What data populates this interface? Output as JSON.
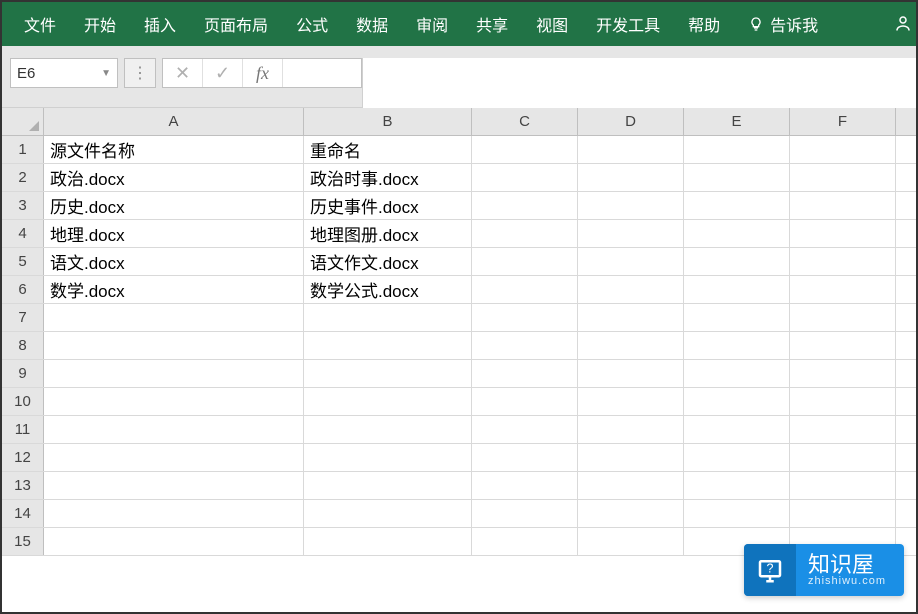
{
  "ribbon": {
    "tabs": [
      "文件",
      "开始",
      "插入",
      "页面布局",
      "公式",
      "数据",
      "审阅",
      "共享",
      "视图",
      "开发工具",
      "帮助"
    ],
    "tellme": "告诉我"
  },
  "namebox": {
    "ref": "E6"
  },
  "fx": {
    "label": "fx"
  },
  "columns": [
    "A",
    "B",
    "C",
    "D",
    "E",
    "F"
  ],
  "col_widths": {
    "A": "col-A",
    "B": "col-B",
    "C": "col-n",
    "D": "col-n",
    "E": "col-n",
    "F": "col-n"
  },
  "rows": [
    {
      "n": "1",
      "A": "源文件名称",
      "B": "重命名"
    },
    {
      "n": "2",
      "A": "政治.docx",
      "B": "政治时事.docx"
    },
    {
      "n": "3",
      "A": "历史.docx",
      "B": "历史事件.docx"
    },
    {
      "n": "4",
      "A": "地理.docx",
      "B": "地理图册.docx"
    },
    {
      "n": "5",
      "A": "语文.docx",
      "B": "语文作文.docx"
    },
    {
      "n": "6",
      "A": "数学.docx",
      "B": "数学公式.docx"
    },
    {
      "n": "7",
      "A": "",
      "B": ""
    },
    {
      "n": "8",
      "A": "",
      "B": ""
    },
    {
      "n": "9",
      "A": "",
      "B": ""
    },
    {
      "n": "10",
      "A": "",
      "B": ""
    },
    {
      "n": "11",
      "A": "",
      "B": ""
    },
    {
      "n": "12",
      "A": "",
      "B": ""
    },
    {
      "n": "13",
      "A": "",
      "B": ""
    },
    {
      "n": "14",
      "A": "",
      "B": ""
    },
    {
      "n": "15",
      "A": "",
      "B": ""
    }
  ],
  "watermark": {
    "title": "知识屋",
    "sub": "zhishiwu.com"
  }
}
